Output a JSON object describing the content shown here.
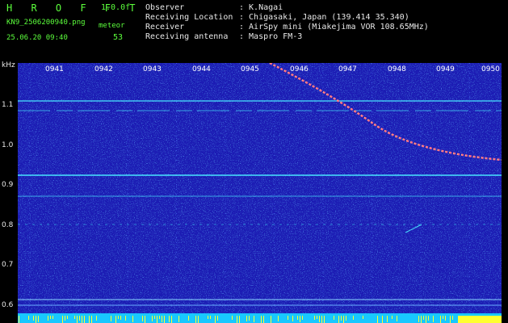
{
  "header": {
    "brand": "H R O F F T",
    "version": "1.0.0f",
    "filename": "KN9_2506200940.png",
    "datetime": "25.06.20 09:40",
    "meteor_label": "meteor",
    "meteor_count": "53",
    "fields": [
      {
        "label": "Observer",
        "value": ": K.Nagai"
      },
      {
        "label": "Receiving Location",
        "value": ": Chigasaki, Japan (139.414 35.340)"
      },
      {
        "label": "Receiver",
        "value": ": AirSpy mini (Miakejima VOR 108.65MHz)"
      },
      {
        "label": "Receiving antenna",
        "value": ": Maspro FM-3"
      }
    ]
  },
  "axis": {
    "unit": "kHz",
    "y_ticks": [
      "1.1",
      "1.0",
      "0.9",
      "0.8",
      "0.7",
      "0.6"
    ],
    "x_ticks": [
      "0941",
      "0942",
      "0943",
      "0944",
      "0945",
      "0946",
      "0947",
      "0948",
      "0949",
      "0950"
    ]
  },
  "colors": {
    "background_plot": "#1a1fb4",
    "line_cyan": "#48e6ff",
    "meteor_trail": "#ff6a8a",
    "bottom_bar": "#18c8ff",
    "bottom_bar_highlight": "#ffff30",
    "header_text_green": "#5cff3c"
  }
}
